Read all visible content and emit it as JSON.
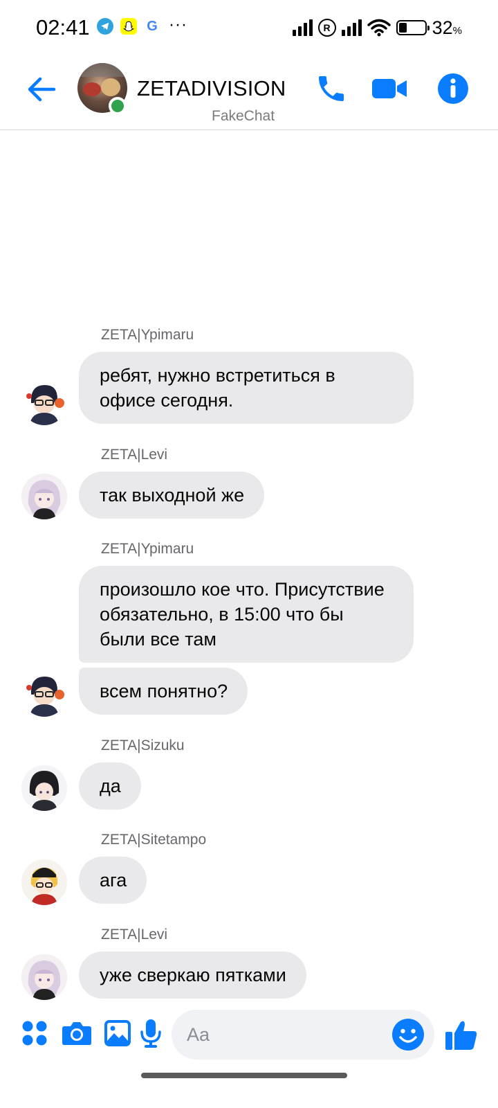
{
  "status_bar": {
    "time": "02:41",
    "notification_icons": [
      "telegram-icon",
      "snapchat-icon",
      "google-icon",
      "more-icon"
    ],
    "more": "···",
    "google": "G",
    "reg": "R",
    "battery_percent": 32,
    "battery_text": "32",
    "battery_unit": "%"
  },
  "header": {
    "title": "ZETADIVISION",
    "subtitle": "FakeChat",
    "online": true
  },
  "messages": [
    {
      "sender": "ZETA|Ypimaru",
      "texts": [
        "ребят, нужно встретиться в офисе сегодня."
      ]
    },
    {
      "sender": "ZETA|Levi",
      "texts": [
        "так выходной же"
      ]
    },
    {
      "sender": "ZETA|Ypimaru",
      "texts": [
        "произошло кое что. Присутствие обязательно, в 15:00 что бы были все там",
        "всем понятно?"
      ]
    },
    {
      "sender": "ZETA|Sizuku",
      "texts": [
        "да"
      ]
    },
    {
      "sender": "ZETA|Sitetampo",
      "texts": [
        "ага"
      ]
    },
    {
      "sender": "ZETA|Levi",
      "texts": [
        "уже сверкаю пятками"
      ]
    }
  ],
  "composer": {
    "placeholder": "Aa",
    "value": ""
  },
  "colors": {
    "accent": "#0a7cff",
    "bubble": "#e9e9eb",
    "online": "#31a24c",
    "sender_text": "#65676b"
  }
}
